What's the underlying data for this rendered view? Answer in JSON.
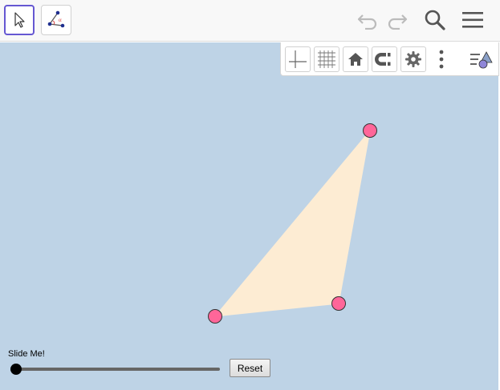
{
  "colors": {
    "toolbar_bg": "#f8f8f8",
    "selected_tool_border": "#6557d2",
    "canvas_bg": "#bed3e6",
    "polygon_fill": "#fdecd3",
    "point_fill": "#ff6699",
    "point_stroke": "#333333",
    "icon_disabled": "#bbbbbb",
    "icon_active": "#555555"
  },
  "toolbar": {
    "tools": [
      {
        "icon": "move-arrow-icon",
        "selected": true
      },
      {
        "icon": "point-tools-icon",
        "selected": false
      }
    ],
    "actions": [
      {
        "icon": "undo-icon",
        "enabled": false
      },
      {
        "icon": "redo-icon",
        "enabled": false
      },
      {
        "icon": "search-icon",
        "enabled": true
      },
      {
        "icon": "hamburger-menu-icon",
        "enabled": true
      }
    ]
  },
  "style_bar": {
    "buttons": [
      "axes-icon",
      "grid-icon",
      "home-icon",
      "point-capture-magnet-icon",
      "gear-icon",
      "more-vertical-icon",
      "toggle-style-bar-icon"
    ]
  },
  "slider": {
    "label": "Slide Me!",
    "value": 0
  },
  "reset_button": {
    "label": "Reset"
  }
}
